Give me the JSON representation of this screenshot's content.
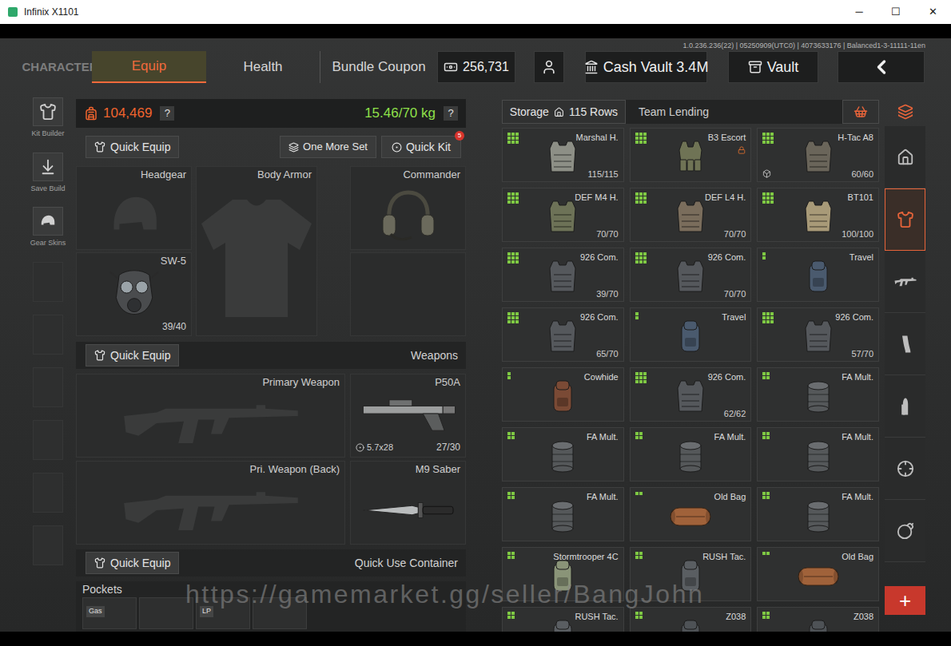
{
  "window": {
    "title": "Infinix X1101",
    "controls": [
      "─",
      "☐",
      "✕"
    ]
  },
  "build_info": "1.0.236.236(22) | 05250909(UTC0) | 4073633176 | Balanced1-3-11111-11en",
  "nav": {
    "tabs": [
      {
        "label": "CHARACTER",
        "selected": false
      },
      {
        "label": "Equip",
        "selected": true
      },
      {
        "label": "Health",
        "selected": false
      },
      {
        "label": "Bundle Coupon",
        "selected": false
      }
    ],
    "currency": "256,731",
    "cash_vault": "Cash Vault 3.4M",
    "vault": "Vault"
  },
  "left_tools": [
    {
      "label": "Kit Builder",
      "kind": "kit"
    },
    {
      "label": "Save Build",
      "kind": "save"
    },
    {
      "label": "Gear Skins",
      "kind": "skins"
    }
  ],
  "loadout": {
    "value": "104,469",
    "weight": "15.46/70 kg",
    "help": "?",
    "quick_equip": "Quick Equip",
    "one_more_set": "One More Set",
    "quick_kit": "Quick Kit",
    "quick_kit_badge": "5",
    "gear": {
      "headgear": {
        "label": "Headgear"
      },
      "body_armor": {
        "label": "Body Armor"
      },
      "headset": {
        "label": "Commander"
      },
      "mask": {
        "label": "SW-5",
        "durability": "39/40"
      }
    },
    "weapons_section": {
      "button": "Quick Equip",
      "title": "Weapons"
    },
    "primary": {
      "label": "Primary Weapon"
    },
    "primary_back": {
      "label": "Pri. Weapon (Back)"
    },
    "sidearm": {
      "label": "P50A",
      "ammo_type": "5.7x28",
      "ammo": "27/30"
    },
    "melee": {
      "label": "M9 Saber"
    },
    "container_section": {
      "button": "Quick Equip",
      "title": "Quick Use Container"
    },
    "pockets": {
      "label": "Pockets",
      "slots": [
        {
          "kind": "item",
          "label": "Gas"
        },
        {
          "kind": "empty"
        },
        {
          "kind": "item",
          "label": "LP"
        },
        {
          "kind": "empty"
        }
      ]
    }
  },
  "storage": {
    "tab": "Storage",
    "rows": "115 Rows",
    "team_lending": "Team Lending",
    "items": [
      {
        "name": "Marshal H.",
        "durability": "115/115",
        "kind": "armor",
        "color": "#8d8f86",
        "grid": [
          3,
          3
        ],
        "locked": false,
        "boxed": false
      },
      {
        "name": "B3 Escort",
        "kind": "rig",
        "color": "#6f7355",
        "grid": [
          3,
          3
        ],
        "locked": true,
        "boxed": false
      },
      {
        "name": "H-Tac A8",
        "durability": "60/60",
        "kind": "armor",
        "color": "#6a655a",
        "grid": [
          3,
          3
        ],
        "locked": false,
        "boxed": true
      },
      {
        "name": "DEF M4 H.",
        "durability": "70/70",
        "kind": "armor",
        "color": "#6d7257",
        "grid": [
          3,
          3
        ],
        "locked": false,
        "boxed": false
      },
      {
        "name": "DEF L4 H.",
        "durability": "70/70",
        "kind": "armor",
        "color": "#7a6d5c",
        "grid": [
          3,
          3
        ],
        "locked": false,
        "boxed": false
      },
      {
        "name": "BT101",
        "durability": "100/100",
        "kind": "armor",
        "color": "#a89a78",
        "grid": [
          3,
          3
        ],
        "locked": false,
        "boxed": false
      },
      {
        "name": "926 Com.",
        "durability": "39/70",
        "kind": "armor",
        "color": "#55585c",
        "grid": [
          3,
          3
        ],
        "locked": false,
        "boxed": false
      },
      {
        "name": "926 Com.",
        "durability": "70/70",
        "kind": "armor",
        "color": "#55585c",
        "grid": [
          3,
          3
        ],
        "locked": false,
        "boxed": false
      },
      {
        "name": "Travel",
        "kind": "backpack",
        "color": "#4a5a6e",
        "grid": [
          1,
          2
        ],
        "locked": false,
        "boxed": false
      },
      {
        "name": "926 Com.",
        "durability": "65/70",
        "kind": "armor",
        "color": "#55585c",
        "grid": [
          3,
          3
        ],
        "locked": false,
        "boxed": false
      },
      {
        "name": "Travel",
        "kind": "backpack",
        "color": "#4a5a6e",
        "grid": [
          1,
          2
        ],
        "locked": false,
        "boxed": false
      },
      {
        "name": "926 Com.",
        "durability": "57/70",
        "kind": "armor",
        "color": "#55585c",
        "grid": [
          3,
          3
        ],
        "locked": false,
        "boxed": false
      },
      {
        "name": "Cowhide",
        "kind": "backpack",
        "color": "#7a4a35",
        "grid": [
          1,
          2
        ],
        "locked": false,
        "boxed": false
      },
      {
        "name": "926 Com.",
        "durability": "62/62",
        "kind": "armor",
        "color": "#55585c",
        "grid": [
          3,
          3
        ],
        "locked": false,
        "boxed": false
      },
      {
        "name": "FA Mult.",
        "kind": "pouch",
        "color": "#55585a",
        "grid": [
          2,
          2
        ],
        "locked": false,
        "boxed": false
      },
      {
        "name": "FA Mult.",
        "kind": "pouch",
        "color": "#55585a",
        "grid": [
          2,
          2
        ],
        "locked": false,
        "boxed": false
      },
      {
        "name": "FA Mult.",
        "kind": "pouch",
        "color": "#55585a",
        "grid": [
          2,
          2
        ],
        "locked": false,
        "boxed": false
      },
      {
        "name": "FA Mult.",
        "kind": "pouch",
        "color": "#55585a",
        "grid": [
          2,
          2
        ],
        "locked": false,
        "boxed": false
      },
      {
        "name": "FA Mult.",
        "kind": "pouch",
        "color": "#55585a",
        "grid": [
          2,
          2
        ],
        "locked": false,
        "boxed": false
      },
      {
        "name": "Old Bag",
        "kind": "duffel",
        "color": "#a0623a",
        "grid": [
          2,
          1
        ],
        "locked": false,
        "boxed": false
      },
      {
        "name": "FA Mult.",
        "kind": "pouch",
        "color": "#55585a",
        "grid": [
          2,
          2
        ],
        "locked": false,
        "boxed": false
      },
      {
        "name": "Stormtrooper 4C",
        "kind": "backpack",
        "color": "#8a9478",
        "grid": [
          2,
          2
        ],
        "locked": false,
        "boxed": false
      },
      {
        "name": "RUSH Tac.",
        "kind": "backpack",
        "color": "#5a5e62",
        "grid": [
          2,
          2
        ],
        "locked": false,
        "boxed": false
      },
      {
        "name": "Old Bag",
        "kind": "duffel",
        "color": "#a0623a",
        "grid": [
          2,
          1
        ],
        "locked": false,
        "boxed": false
      },
      {
        "name": "RUSH Tac.",
        "kind": "backpack",
        "color": "#5a5e62",
        "grid": [
          2,
          2
        ],
        "locked": false,
        "boxed": false
      },
      {
        "name": "Z038",
        "kind": "backpack",
        "color": "#4e5256",
        "grid": [
          2,
          2
        ],
        "locked": false,
        "boxed": false
      },
      {
        "name": "Z038",
        "kind": "backpack",
        "color": "#4e5256",
        "grid": [
          2,
          2
        ],
        "locked": false,
        "boxed": false
      }
    ]
  },
  "categories": [
    {
      "kind": "home",
      "selected": false
    },
    {
      "kind": "armor",
      "selected": true
    },
    {
      "kind": "rifle",
      "selected": false
    },
    {
      "kind": "magazine",
      "selected": false
    },
    {
      "kind": "ammo",
      "selected": false
    },
    {
      "kind": "scope",
      "selected": false
    },
    {
      "kind": "grenade",
      "selected": false
    }
  ],
  "add_button": "+",
  "watermark": "https://gamemarket.gg/seller/BangJohn"
}
